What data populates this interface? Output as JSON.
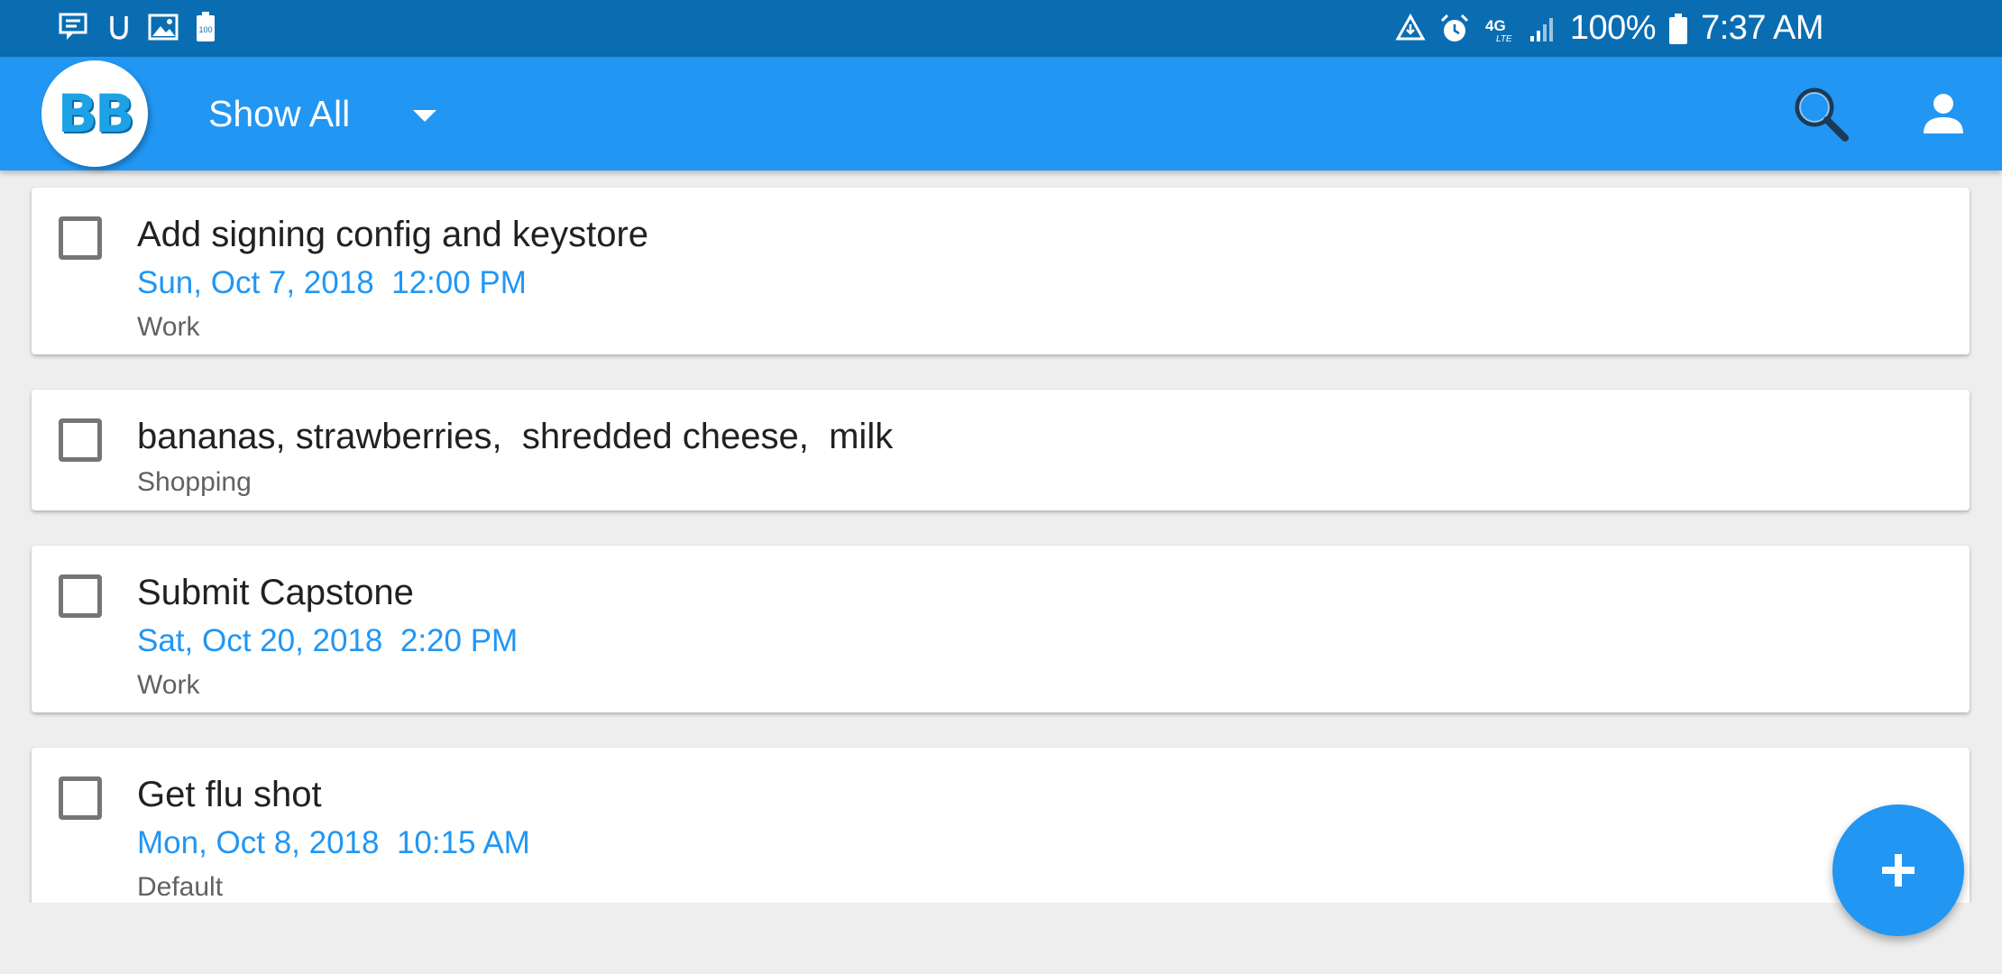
{
  "status_bar": {
    "left_icons": [
      "message-notification-icon",
      "udemy-icon",
      "image-icon",
      "battery-saver-icon"
    ],
    "right_icons": [
      "data-saver-icon",
      "alarm-icon",
      "4g-lte-icon",
      "signal-icon",
      "battery-icon"
    ],
    "network_label": "4G",
    "battery_percent": "100%",
    "time": "7:37 AM"
  },
  "app_bar": {
    "logo_text": "BB",
    "filter_label": "Show All",
    "actions": [
      "search-icon",
      "account-icon"
    ]
  },
  "tasks": [
    {
      "title": "Add signing config and keystore",
      "date": "Sun, Oct 7, 2018",
      "time": "12:00 PM",
      "category": "Work",
      "checked": false
    },
    {
      "title": "bananas, strawberries,  shredded cheese,  milk",
      "category": "Shopping",
      "checked": false
    },
    {
      "title": "Submit Capstone",
      "date": "Sat, Oct 20, 2018",
      "time": "2:20 PM",
      "category": "Work",
      "checked": false
    },
    {
      "title": "Get flu shot",
      "date": "Mon, Oct 8, 2018",
      "time": "10:15 AM",
      "category": "Default",
      "checked": false
    }
  ],
  "fab": {
    "label": "+"
  },
  "colors": {
    "status_bar": "#0a6db2",
    "app_bar": "#2196f3",
    "accent": "#2196f3",
    "background": "#eeeeee"
  }
}
